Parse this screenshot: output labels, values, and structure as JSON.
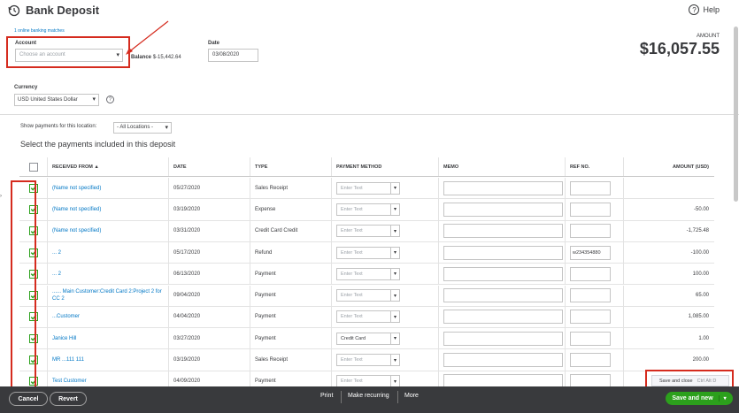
{
  "header": {
    "title": "Bank Deposit",
    "help_label": "Help"
  },
  "form": {
    "online_matches": "1 online banking matches",
    "account_label": "Account",
    "account_placeholder": "Choose an account",
    "balance_label": "Balance",
    "balance_value": "$-15,442.64",
    "date_label": "Date",
    "date_value": "03/08/2020",
    "amount_label": "AMOUNT",
    "amount_value": "$16,057.55",
    "currency_label": "Currency",
    "currency_value": "USD United States Dollar",
    "filter_label": "Show payments for this location:",
    "filter_value": "- All Locations -",
    "section_title": "Select the payments included in this deposit"
  },
  "table": {
    "headers": {
      "received_from": "RECEIVED FROM ▲",
      "date": "DATE",
      "type": "TYPE",
      "payment_method": "PAYMENT METHOD",
      "memo": "MEMO",
      "ref_no": "REF NO.",
      "amount": "AMOUNT (USD)"
    },
    "pm_placeholder": "Enter Text",
    "rows": [
      {
        "received_from": "(Name not specified)",
        "date": "05/27/2020",
        "type": "Sales Receipt",
        "payment_method": "",
        "ref_no": "",
        "amount": "",
        "checked": true
      },
      {
        "received_from": "(Name not specified)",
        "date": "03/19/2020",
        "type": "Expense",
        "payment_method": "",
        "ref_no": "",
        "amount": "-50.00",
        "checked": true
      },
      {
        "received_from": "(Name not specified)",
        "date": "03/31/2020",
        "type": "Credit Card Credit",
        "payment_method": "",
        "ref_no": "",
        "amount": "-1,725.48",
        "checked": true
      },
      {
        "received_from": "... 2",
        "date": "05/17/2020",
        "type": "Refund",
        "payment_method": "",
        "ref_no": "w234354880",
        "amount": "-100.00",
        "checked": true
      },
      {
        "received_from": "... 2",
        "date": "06/13/2020",
        "type": "Payment",
        "payment_method": "",
        "ref_no": "",
        "amount": "100.00",
        "checked": true
      },
      {
        "received_from": "...... Main Customer:Credit Card 2:Project 2 for CC 2",
        "date": "09/04/2020",
        "type": "Payment",
        "payment_method": "",
        "ref_no": "",
        "amount": "65.00",
        "checked": true
      },
      {
        "received_from": "...Customer",
        "date": "04/04/2020",
        "type": "Payment",
        "payment_method": "",
        "ref_no": "",
        "amount": "1,085.00",
        "checked": true
      },
      {
        "received_from": "Janice Hill",
        "date": "03/27/2020",
        "type": "Payment",
        "payment_method": "Credit Card",
        "ref_no": "",
        "amount": "1.00",
        "checked": true
      },
      {
        "received_from": "MR ...111 111",
        "date": "03/19/2020",
        "type": "Sales Receipt",
        "payment_method": "",
        "ref_no": "",
        "amount": "200.00",
        "checked": true
      },
      {
        "received_from": "Test Customer",
        "date": "04/09/2020",
        "type": "Payment",
        "payment_method": "",
        "ref_no": "",
        "amount": "",
        "checked": true
      }
    ]
  },
  "footer": {
    "cancel": "Cancel",
    "revert": "Revert",
    "print": "Print",
    "make_recurring": "Make recurring",
    "more": "More",
    "save_and_new": "Save and new",
    "save_and_close": "Save and close",
    "save_and_close_shortcut": "Ctrl Alt D"
  },
  "colors": {
    "accent_green": "#2ca01c",
    "link_blue": "#0077c5",
    "annotation_red": "#d52b1e",
    "footer_bg": "#393a3d"
  }
}
